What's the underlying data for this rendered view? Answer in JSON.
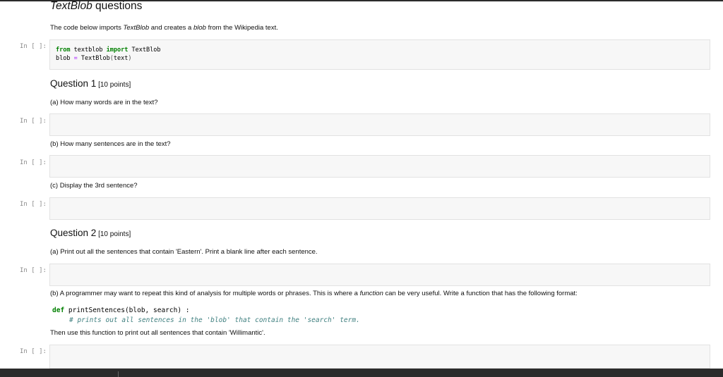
{
  "title": {
    "italic": "TextBlob",
    "rest": " questions"
  },
  "intro": {
    "pre": "The code below imports ",
    "italic1": "TextBlob",
    "mid": " and creates a ",
    "italic2": "blob",
    "post": " from the Wikipedia text."
  },
  "prompt": "In [ ]:",
  "code1": {
    "line1_kw1": "from",
    "line1_mod": " textblob ",
    "line1_kw2": "import",
    "line1_name": " TextBlob",
    "line2_a": "blob ",
    "line2_op": "=",
    "line2_b": " TextBlob",
    "line2_po": "(",
    "line2_arg": "text",
    "line2_pc": ")"
  },
  "q1": {
    "title": "Question 1",
    "points": " [10 points]",
    "a": "(a) How many words are in the text?",
    "b": "(b) How many sentences are in the text?",
    "c": "(c) Display the 3rd sentence?"
  },
  "q2": {
    "title": "Question 2",
    "points": " [10 points]",
    "a": "(a) Print out all the sentences that contain 'Eastern'. Print a blank line after each sentence.",
    "b_pre": "(b) A programmer may want to repeat this kind of analysis for multiple words or phrases. This is where a ",
    "b_italic": "function",
    "b_post": " can be very useful. Write a function that has the following format:",
    "def_kw": "def",
    "def_sig": " printSentences(blob, search) :",
    "def_comment": "# prints out all sentences in the 'blob' that contain the 'search' term.",
    "then": "Then use this function to print out all sentences that contain 'Willimantic'."
  }
}
